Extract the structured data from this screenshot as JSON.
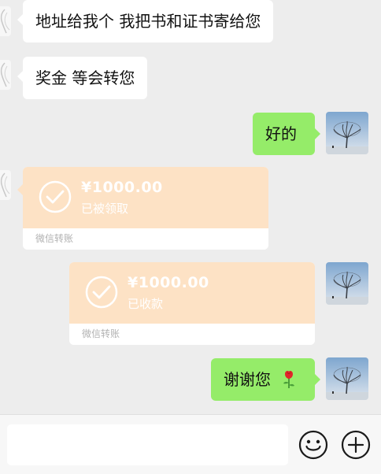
{
  "messages": [
    {
      "side": "left",
      "type": "text",
      "text": "地址给我个 我把书和证书寄给您"
    },
    {
      "side": "left",
      "type": "text",
      "text": "奖金 等会转您"
    },
    {
      "side": "right",
      "type": "text",
      "text": "好的"
    },
    {
      "side": "left",
      "type": "transfer",
      "amount": "¥1000.00",
      "status": "已被领取",
      "source": "微信转账"
    },
    {
      "side": "right",
      "type": "transfer",
      "amount": "¥1000.00",
      "status": "已收款",
      "source": "微信转账"
    },
    {
      "side": "right",
      "type": "text",
      "text": "谢谢您",
      "emoji": "rose-emoji"
    }
  ],
  "input_bar": {
    "input_value": "",
    "emoji_icon": "smiley-icon",
    "more_icon": "plus-icon"
  },
  "colors": {
    "background": "#ededed",
    "bubble_self": "#95ec69",
    "bubble_other": "#ffffff",
    "transfer_card": "#fde2c5"
  }
}
